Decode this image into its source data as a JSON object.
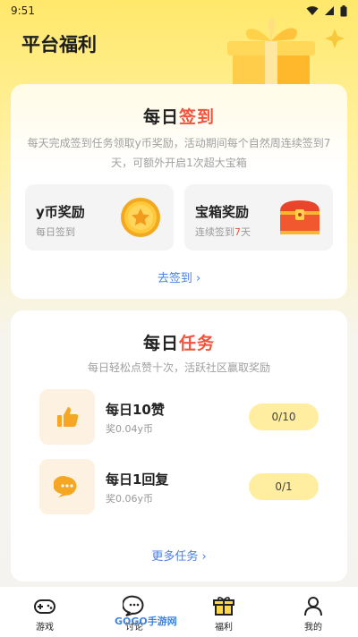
{
  "status_bar": {
    "time": "9:51"
  },
  "header": {
    "title": "平台福利"
  },
  "checkin": {
    "heading_prefix": "每日",
    "heading_accent": "签到",
    "description": "每天完成签到任务领取y币奖励，活动期间每个自然周连续签到7天，可额外开启1次超大宝箱",
    "rewards": [
      {
        "title": "y币奖励",
        "subtitle": "每日签到",
        "icon": "coin-icon"
      },
      {
        "title": "宝箱奖励",
        "subtitle_prefix": "连续签到",
        "subtitle_num": "7",
        "subtitle_suffix": "天",
        "icon": "treasure-chest-icon"
      }
    ],
    "link_label": "去签到"
  },
  "tasks": {
    "heading_prefix": "每日",
    "heading_accent": "任务",
    "description": "每日轻松点赞十次，活跃社区赢取奖励",
    "items": [
      {
        "name": "每日10赞",
        "reward": "奖0.04y币",
        "progress": "0/10",
        "icon": "thumbs-up-icon"
      },
      {
        "name": "每日1回复",
        "reward": "奖0.06y币",
        "progress": "0/1",
        "icon": "comment-icon"
      }
    ],
    "link_label": "更多任务"
  },
  "tabbar": {
    "items": [
      {
        "label": "游戏",
        "icon": "gamepad-icon"
      },
      {
        "label": "讨论",
        "icon": "chat-icon"
      },
      {
        "label": "福利",
        "icon": "gift-icon",
        "active": true
      },
      {
        "label": "我的",
        "icon": "user-icon"
      }
    ]
  },
  "watermark": "GOGO手游网",
  "colors": {
    "accent": "#f2533e",
    "link": "#4a7ee8",
    "progress_bg": "#ffeea0",
    "header_bg": "#ffe86a"
  }
}
